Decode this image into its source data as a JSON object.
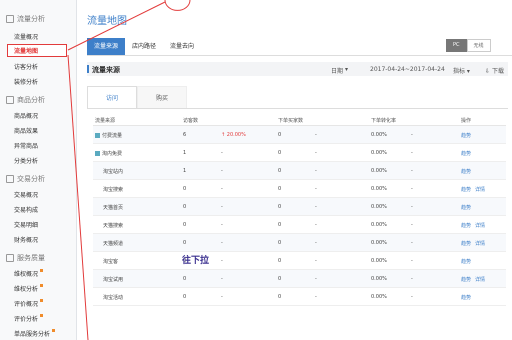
{
  "sidebar": {
    "sections": [
      {
        "title": "流量分析",
        "items": [
          "流量概况",
          "流量地图",
          "访客分析",
          "装修分析"
        ]
      },
      {
        "title": "商品分析",
        "items": [
          "商品概况",
          "商品效果",
          "异常商品",
          "分类分析"
        ]
      },
      {
        "title": "交易分析",
        "items": [
          "交易概况",
          "交易构成",
          "交易明细",
          "财务概况"
        ]
      },
      {
        "title": "服务质量",
        "items": [
          "维权概况",
          "维权分析",
          "评价概况",
          "评价分析",
          "单品服务分析"
        ]
      }
    ],
    "active_item": "流量地图"
  },
  "header": {
    "title": "流量地图",
    "tabs": [
      "流量来源",
      "店内路径",
      "流量去向"
    ],
    "toggle": [
      "PC",
      "无线"
    ]
  },
  "section": {
    "title": "流量来源",
    "date_label": "日期",
    "date_range": "2017-04-24~2017-04-24",
    "metric_label": "指标",
    "download_label": "下载",
    "subtabs": [
      "访问",
      "购买"
    ]
  },
  "table": {
    "headers": [
      "流量来源",
      "访客数",
      "",
      "下单买家数",
      "",
      "下单转化率",
      "",
      "操作"
    ],
    "rows": [
      {
        "source": "付费流量",
        "checked": true,
        "visitors": "6",
        "trend": "↑ 20.00%",
        "buyers": "0",
        "buyers_trend": "-",
        "conv": "0.00%",
        "conv_trend": "-",
        "ops": [
          "趋势"
        ]
      },
      {
        "source": "淘内免费",
        "checked": true,
        "visitors": "1",
        "trend": "-",
        "buyers": "0",
        "buyers_trend": "-",
        "conv": "0.00%",
        "conv_trend": "-",
        "ops": [
          "趋势"
        ]
      },
      {
        "source": "淘宝站内",
        "checked": false,
        "visitors": "1",
        "trend": "-",
        "buyers": "0",
        "buyers_trend": "-",
        "conv": "0.00%",
        "conv_trend": "-",
        "ops": [
          "趋势"
        ]
      },
      {
        "source": "淘宝搜索",
        "checked": false,
        "visitors": "0",
        "trend": "-",
        "buyers": "0",
        "buyers_trend": "-",
        "conv": "0.00%",
        "conv_trend": "-",
        "ops": [
          "趋势",
          "详情"
        ]
      },
      {
        "source": "天猫首页",
        "checked": false,
        "visitors": "0",
        "trend": "-",
        "buyers": "0",
        "buyers_trend": "-",
        "conv": "0.00%",
        "conv_trend": "-",
        "ops": [
          "趋势"
        ]
      },
      {
        "source": "天猫搜索",
        "checked": false,
        "visitors": "0",
        "trend": "-",
        "buyers": "0",
        "buyers_trend": "-",
        "conv": "0.00%",
        "conv_trend": "-",
        "ops": [
          "趋势",
          "详情"
        ]
      },
      {
        "source": "天猫频道",
        "checked": false,
        "visitors": "0",
        "trend": "-",
        "buyers": "0",
        "buyers_trend": "-",
        "conv": "0.00%",
        "conv_trend": "-",
        "ops": [
          "趋势",
          "详情"
        ]
      },
      {
        "source": "淘宝客",
        "checked": false,
        "visitors": "0",
        "trend": "-",
        "buyers": "0",
        "buyers_trend": "-",
        "conv": "0.00%",
        "conv_trend": "-",
        "ops": [
          "趋势"
        ]
      },
      {
        "source": "淘宝试用",
        "checked": false,
        "visitors": "0",
        "trend": "-",
        "buyers": "0",
        "buyers_trend": "-",
        "conv": "0.00%",
        "conv_trend": "-",
        "ops": [
          "趋势",
          "详情"
        ]
      },
      {
        "source": "淘宝活动",
        "checked": false,
        "visitors": "0",
        "trend": "-",
        "buyers": "0",
        "buyers_trend": "-",
        "conv": "0.00%",
        "conv_trend": "-",
        "ops": [
          "趋势"
        ]
      }
    ]
  },
  "annotation": {
    "text": "往下拉",
    "color": "#e23b3b"
  }
}
